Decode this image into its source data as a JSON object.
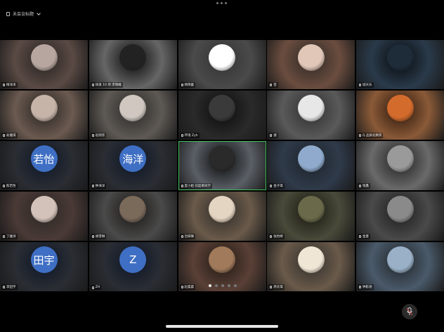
{
  "header": {
    "title": "未会议标题"
  },
  "tiles": [
    {
      "name": "梅洋洋",
      "bg": "#5a4a44",
      "avatar": "#b7a6a0"
    },
    {
      "name": "研发 10 周 李晓峰",
      "bg": "#666666",
      "avatar": "#222222"
    },
    {
      "name": "杨晓蕾",
      "bg": "#4a4a4a",
      "avatar": "#ffffff"
    },
    {
      "name": "芸",
      "bg": "#6b4d3f",
      "avatar": "#e0c7b8"
    },
    {
      "name": "城天乐",
      "bg": "#2a3a4a",
      "avatar": "#1e2c3a"
    },
    {
      "name": "俞雅琪",
      "bg": "#6b5a50",
      "avatar": "#c6b4a9"
    },
    {
      "name": "赵雨欣",
      "bg": "#5e5954",
      "avatar": "#cfc7c0"
    },
    {
      "name": "环境 Zyh",
      "bg": "#2a2a2a",
      "avatar": "#3a3a3a"
    },
    {
      "name": "搜",
      "bg": "#5a5a5a",
      "avatar": "#e7e7e7"
    },
    {
      "name": "Q 品质化精英",
      "bg": "#8a5a38",
      "avatar": "#d36b2d"
    },
    {
      "name": "陈若怡",
      "bg": "#2a2d33",
      "avatar": "#3f6fc4",
      "text": "若怡"
    },
    {
      "name": "钟海洋",
      "bg": "#2a2d33",
      "avatar": "#3f6fc4",
      "text": "海洋"
    },
    {
      "name": "度小姐 前度果同学",
      "bg": "#5a5f66",
      "avatar": "#2a2a2a",
      "active": true
    },
    {
      "name": "金子琪",
      "bg": "#2f3a4a",
      "avatar": "#8faacc"
    },
    {
      "name": "钱鑫",
      "bg": "#6a6a6a",
      "avatar": "#9a9a9a"
    },
    {
      "name": "丁雅诗",
      "bg": "#4a3a36",
      "avatar": "#d3c2ba"
    },
    {
      "name": "胡雪琳",
      "bg": "#4a4a4a",
      "avatar": "#7a6a5a"
    },
    {
      "name": "吕梓琳",
      "bg": "#6a5a4a",
      "avatar": "#e4d4c2"
    },
    {
      "name": "张怡婷",
      "bg": "#4a4a3a",
      "avatar": "#6a6a4a"
    },
    {
      "name": "金夏",
      "bg": "#4a4a4a",
      "avatar": "#8a8a8a"
    },
    {
      "name": "李田宇",
      "bg": "#2a2d33",
      "avatar": "#3f6fc4",
      "text": "田宇"
    },
    {
      "name": "ZH",
      "bg": "#2a2d33",
      "avatar": "#3f6fc4",
      "text": "Z"
    },
    {
      "name": "赵晨晨",
      "bg": "#5a4036",
      "avatar": "#a07a5a"
    },
    {
      "name": "周天琪",
      "bg": "#6a5a4a",
      "avatar": "#f0e6d6"
    },
    {
      "name": "钟影涵",
      "bg": "#4a5a6a",
      "avatar": "#9ab0c6"
    }
  ]
}
